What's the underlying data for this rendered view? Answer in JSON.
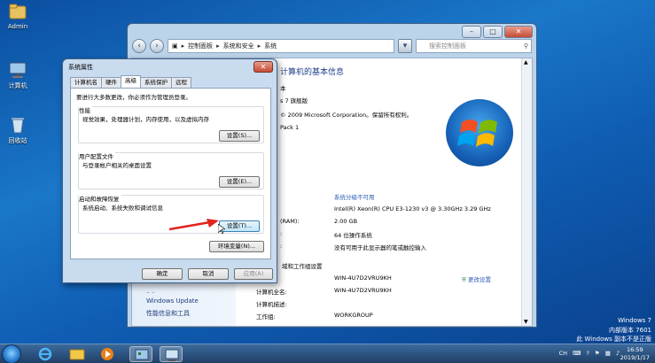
{
  "desktop": {
    "icons": [
      {
        "label": "Admin",
        "icon": "user-folder-icon"
      },
      {
        "label": "计算机",
        "icon": "computer-icon"
      },
      {
        "label": "回收站",
        "icon": "recycle-bin-icon"
      }
    ]
  },
  "control_panel": {
    "breadcrumb": [
      "控制面板",
      "系统和安全",
      "系统"
    ],
    "search_placeholder": "搜索控制面板",
    "heading": "计算机的基本信息",
    "edition_label": "本",
    "edition_value": "s 7 旗舰版",
    "copyright": "© 2009 Microsoft Corporation。保留所有权利。",
    "service_pack": "Pack 1",
    "rating_label": "",
    "rating_value": "系统分级不可用",
    "processor_value": "Intel(R) Xeon(R) CPU E3-1230 v3 @ 3.30GHz   3.29 GHz",
    "ram_label": "(RAM):",
    "ram_value": "2.00 GB",
    "system_type_label": ":",
    "system_type_value": "64 位操作系统",
    "pen_label": ":",
    "pen_value": "没有可用于此显示器的笔或触控输入",
    "domain_section": "域和工作组设置",
    "computer_name_value": "WIN-4U7D2VRU9KH",
    "change_settings": "更改设置",
    "full_name_label": "计算机全名:",
    "full_name_value": "WIN-4U7D2VRU9KH",
    "description_label": "计算机描述:",
    "workgroup_label": "工作组:",
    "workgroup_value": "WORKGROUP",
    "left_links": [
      "Windows Update",
      "性能信息和工具"
    ]
  },
  "dialog": {
    "title": "系统属性",
    "tabs": [
      "计算机名",
      "硬件",
      "高级",
      "系统保护",
      "远程"
    ],
    "active_tab": 2,
    "intro": "要进行大多数更改，你必须作为管理员登录。",
    "perf_title": "性能",
    "perf_text": "视觉效果，处理器计划，内存使用，以及虚拟内存",
    "profile_title": "用户配置文件",
    "profile_text": "与登录帐户相关的桌面设置",
    "startup_title": "启动和故障恢复",
    "startup_text": "系统启动、系统失败和调试信息",
    "settings_button": "设置(S)...",
    "settings_button_e": "设置(E)...",
    "settings_button_t": "设置(T)...",
    "env_button": "环境变量(N)...",
    "ok": "确定",
    "cancel": "取消",
    "apply": "应用(A)"
  },
  "watermark": {
    "line1": "Windows 7",
    "line2": "内部版本 7601",
    "line3": "此 Windows 副本不是正版"
  },
  "taskbar": {
    "lang": "CH",
    "time": "16:59",
    "date": "2019/1/17"
  }
}
